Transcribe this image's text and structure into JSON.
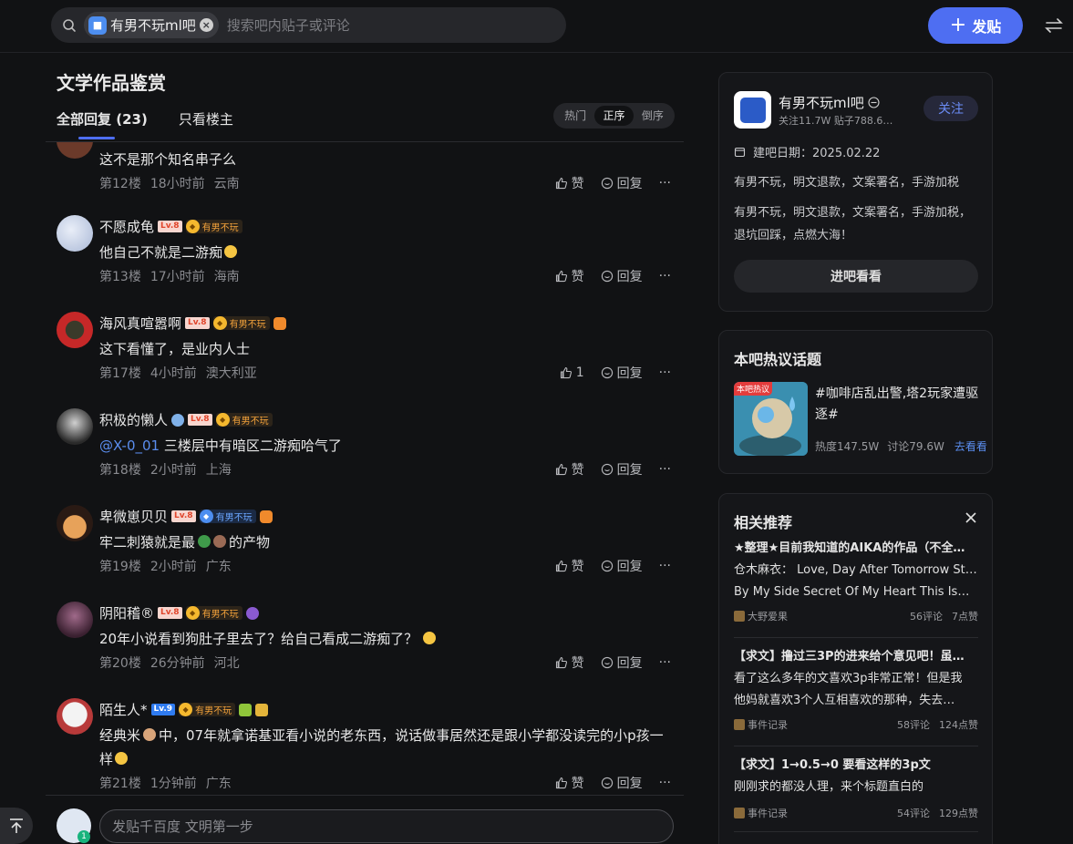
{
  "search": {
    "bar_chip": "有男不玩ml吧",
    "placeholder": "搜索吧内贴子或评论"
  },
  "header": {
    "post_button": "发贴"
  },
  "thread": {
    "title": "文学作品鉴赏",
    "tabs": [
      "全部回复 (23)",
      "只看楼主"
    ],
    "sort": [
      "热门",
      "正序",
      "倒序"
    ],
    "sort_selected": "正序"
  },
  "actions": {
    "like": "赞",
    "reply": "回复",
    "more": "···"
  },
  "replies": [
    {
      "name": "",
      "text": "这不是那个知名串子么",
      "floor": "第12楼",
      "time": "18小时前",
      "loc": "云南",
      "likes": "赞"
    },
    {
      "name": "不愿成龟",
      "level": "Lv.8",
      "badge": "有男不玩",
      "text": "他自己不就是二游痴",
      "floor": "第13楼",
      "time": "17小时前",
      "loc": "海南",
      "likes": "赞"
    },
    {
      "name": "海风真喧嚣啊",
      "level": "Lv.8",
      "badge": "有男不玩",
      "text": "这下看懂了，是业内人士",
      "floor": "第17楼",
      "time": "4小时前",
      "loc": "澳大利亚",
      "likes": "1"
    },
    {
      "name": "积极的懒人",
      "level": "Lv.8",
      "badge": "有男不玩",
      "mention": "@X-0_01",
      "text": " 三楼层中有暗区二游痴哈气了",
      "floor": "第18楼",
      "time": "2小时前",
      "loc": "上海",
      "likes": "赞"
    },
    {
      "name": "卑微崽贝贝",
      "level": "Lv.8",
      "badge": "有男不玩",
      "text_a": "牢二刺猿就是最",
      "text_b": "的产物",
      "floor": "第19楼",
      "time": "2小时前",
      "loc": "广东",
      "likes": "赞"
    },
    {
      "name": "阴阳稽®",
      "level": "Lv.8",
      "badge": "有男不玩",
      "text": "20年小说看到狗肚子里去了？给自己看成二游痴了？",
      "floor": "第20楼",
      "time": "26分钟前",
      "loc": "河北",
      "likes": "赞"
    },
    {
      "name": "陌生人*",
      "level": "Lv.9",
      "badge": "有男不玩",
      "text_a": "经典米",
      "text_b": "中，07年就拿诺基亚看小说的老东西，说话做事居然还是跟小学都没读完的小p孩一样",
      "floor": "第21楼",
      "time": "1分钟前",
      "loc": "广东",
      "likes": "赞"
    }
  ],
  "composer": {
    "placeholder": "发贴千百度 文明第一步",
    "badge": "1"
  },
  "bar_info": {
    "name": "有男不玩ml吧",
    "follow_count": "关注11.7W",
    "post_count": "贴子788.6…",
    "follow_button": "关注",
    "created": "建吧日期：2025.02.22",
    "slogan": "有男不玩，明文退款，文案署名，手游加税",
    "description": "有男不玩，明文退款，文案署名，手游加税，退坑回踩，点燃大海！",
    "enter_button": "进吧看看"
  },
  "hot_topics": {
    "heading": "本吧热议话题",
    "tag": "本吧热议",
    "title": "#咖啡店乱出警,塔2玩家遭驱逐#",
    "heat": "热度147.5W",
    "discuss": "讨论79.6W",
    "go": "去看看"
  },
  "recommend": {
    "heading": "相关推荐",
    "items": [
      {
        "title": "★整理★目前我知道的AIKA的作品（不全…",
        "line1": "仓木麻衣： Love, Day After Tomorrow Stay",
        "line2": "By My Side Secret Of My Heart This Is…",
        "source": "大野爱果",
        "comments": "56评论",
        "likes": "7点赞"
      },
      {
        "title": "【求文】撸过三3P的进来给个意见吧！虽…",
        "line1": "看了这么多年的文喜欢3p非常正常！但是我",
        "line2": "他妈就喜欢3个人互相喜欢的那种，失去…",
        "source": "事件记录",
        "comments": "58评论",
        "likes": "124点赞"
      },
      {
        "title": "【求文】1→0.5→0 要看这样的3p文",
        "line1": "刚刚求的都没人理，来个标题直白的",
        "line2": "",
        "source": "事件记录",
        "comments": "54评论",
        "likes": "129点赞"
      }
    ]
  },
  "colors": {
    "accent": "#4e6ef2",
    "background": "#111214",
    "link": "#5a8dee"
  }
}
